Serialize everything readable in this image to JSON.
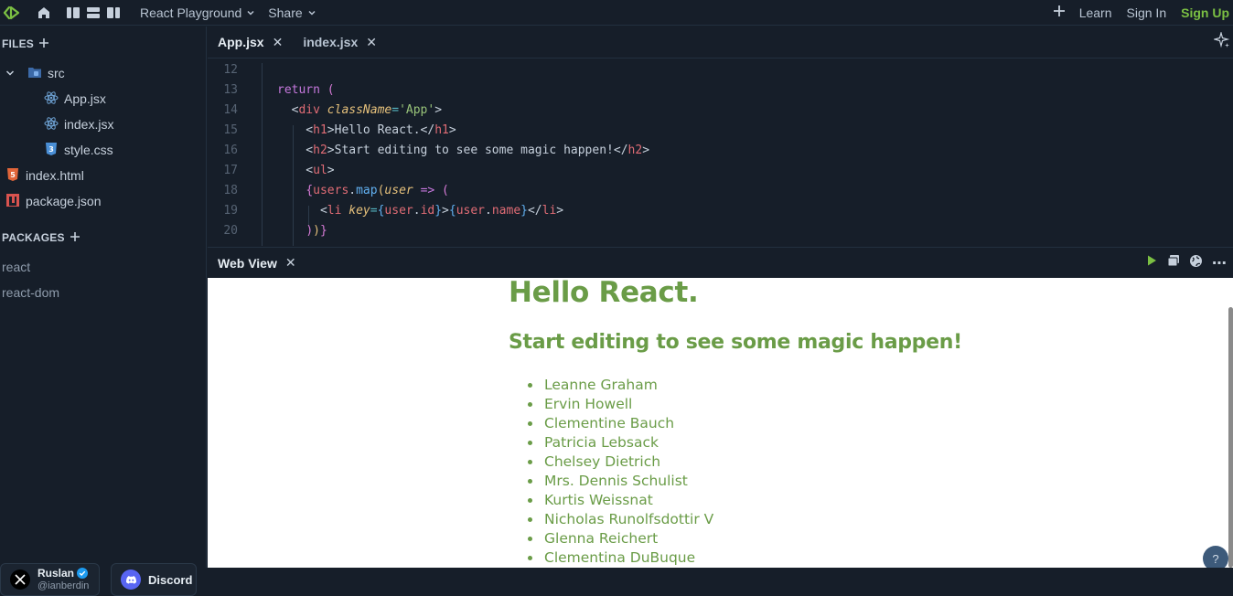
{
  "topbar": {
    "project_menu": "React Playground",
    "share_menu": "Share",
    "learn": "Learn",
    "sign_in": "Sign In",
    "sign_up": "Sign Up"
  },
  "files": {
    "title": "FILES",
    "folder": "src",
    "items": [
      "App.jsx",
      "index.jsx",
      "style.css"
    ],
    "root_items": [
      "index.html",
      "package.json"
    ]
  },
  "packages": {
    "title": "PACKAGES",
    "items": [
      "react",
      "react-dom"
    ]
  },
  "social": {
    "user_name": "Ruslan",
    "user_handle": "@ianberdin",
    "discord": "Discord"
  },
  "editor": {
    "tabs": [
      "App.jsx",
      "index.jsx"
    ],
    "active_tab": "App.jsx",
    "line_numbers": [
      "12",
      "13",
      "14",
      "15",
      "16",
      "17",
      "18",
      "19",
      "20"
    ],
    "code": [
      "",
      "return (",
      "  <div className='App'>",
      "    <h1>Hello React.</h1>",
      "    <h2>Start editing to see some magic happen!</h2>",
      "    <ul>",
      "    {users.map(user => (",
      "      <li key={user.id}>{user.name}</li>",
      "    ))}"
    ]
  },
  "webview_panel": {
    "tab": "Web View"
  },
  "preview": {
    "h1": "Hello React.",
    "h2": "Start editing to see some magic happen!",
    "users": [
      "Leanne Graham",
      "Ervin Howell",
      "Clementine Bauch",
      "Patricia Lebsack",
      "Chelsey Dietrich",
      "Mrs. Dennis Schulist",
      "Kurtis Weissnat",
      "Nicholas Runolfsdottir V",
      "Glenna Reichert",
      "Clementina DuBuque"
    ],
    "help": "?"
  },
  "colors": {
    "accent_green": "#7bc043",
    "preview_green": "#6a9c47",
    "bg": "#161e29"
  },
  "icons": [
    "logo-icon",
    "home-icon",
    "layout-columns-icon",
    "layout-rows-icon",
    "layout-sidebar-icon",
    "chevron-down-icon",
    "plus-icon",
    "react-icon",
    "css-icon",
    "html-icon",
    "npm-icon",
    "sparkle-icon",
    "play-icon",
    "window-icon",
    "globe-icon",
    "more-icon",
    "verified-icon",
    "x-logo-icon",
    "discord-icon"
  ]
}
